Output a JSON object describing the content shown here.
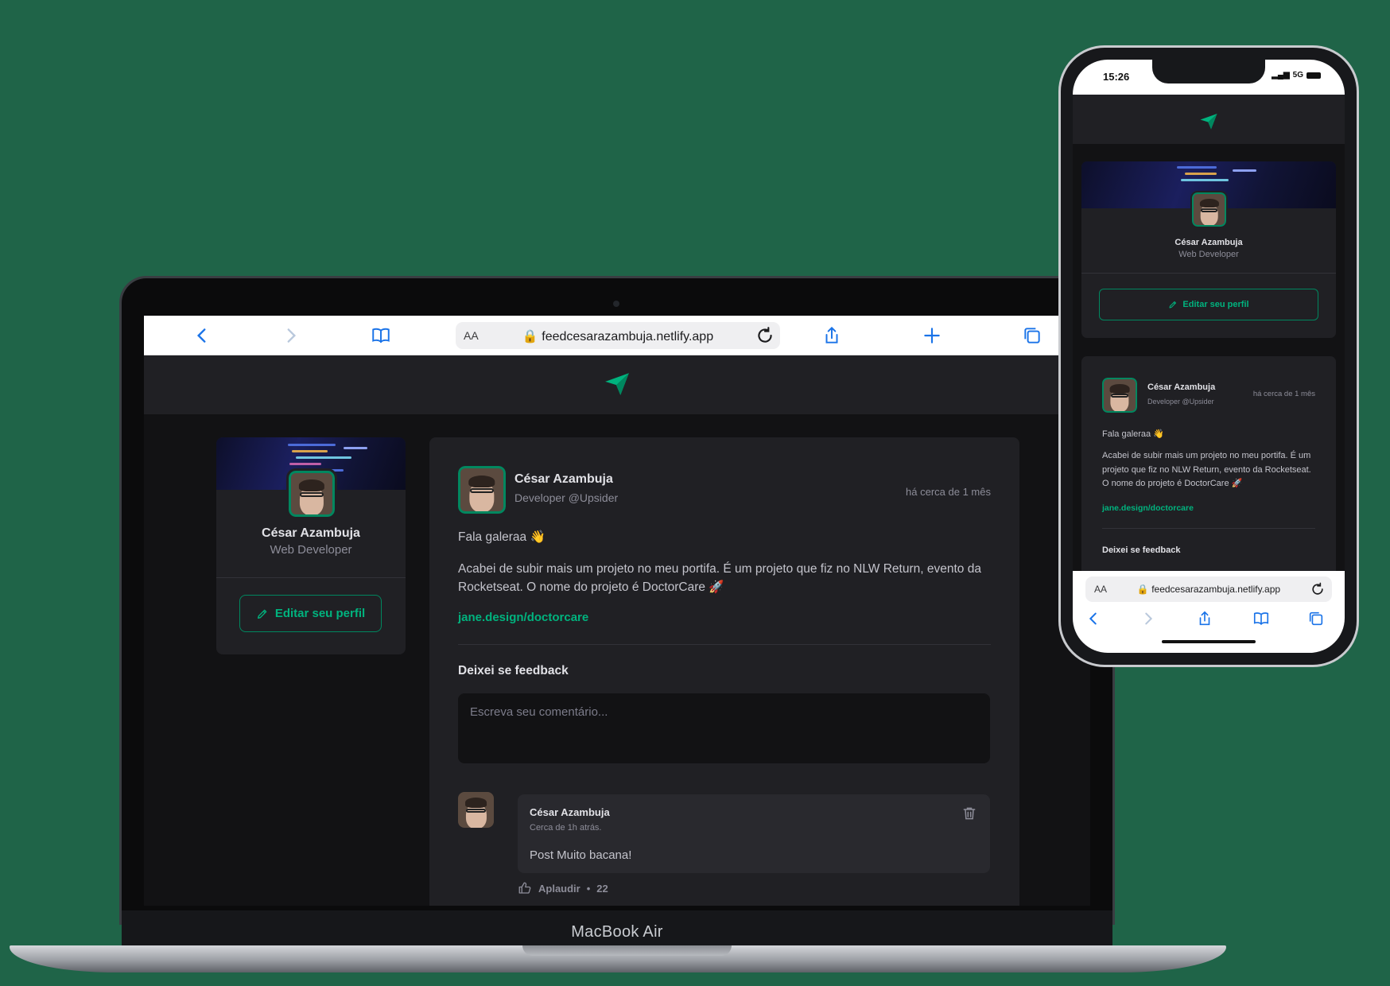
{
  "colors": {
    "background": "#1f6448",
    "accent": "#00b37e",
    "accent_border": "#00875f",
    "card": "#202024",
    "page": "#121214"
  },
  "browser": {
    "url": "feedcesarazambuja.netlify.app",
    "reader_label": "AA"
  },
  "device_label": "MacBook Air",
  "app": {
    "logo_icon": "paper-plane-icon"
  },
  "profile": {
    "name": "César Azambuja",
    "role": "Web Developer",
    "edit_label": "Editar seu perfil"
  },
  "post": {
    "author": "César Azambuja",
    "role": "Developer @Upsider",
    "time": "há cerca de 1 mês",
    "greeting": "Fala galeraa 👋",
    "body": "Acabei de subir mais um projeto no meu portifa. É um projeto que fiz no NLW Return, evento da Rocketseat. O nome do projeto é DoctorCare 🚀",
    "link": "jane.design/doctorcare",
    "feedback_title": "Deixei se feedback",
    "comment_placeholder": "Escreva seu comentário..."
  },
  "comment": {
    "author": "César Azambuja",
    "time": "Cerca de 1h atrás.",
    "text": "Post Muito bacana!",
    "applaud_label": "Aplaudir",
    "applaud_sep": "•",
    "applaud_count": "22"
  },
  "phone": {
    "time": "15:26",
    "network": "5G"
  }
}
